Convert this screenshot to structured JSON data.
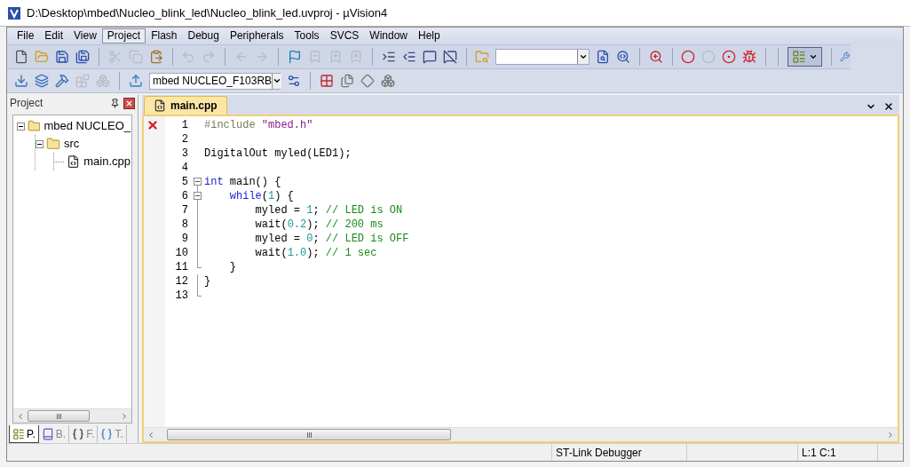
{
  "window": {
    "title": "D:\\Desktop\\mbed\\Nucleo_blink_led\\Nucleo_blink_led.uvproj - µVision4"
  },
  "menu": [
    {
      "label": "File",
      "selected": false
    },
    {
      "label": "Edit",
      "selected": false
    },
    {
      "label": "View",
      "selected": false
    },
    {
      "label": "Project",
      "selected": true
    },
    {
      "label": "Flash",
      "selected": false
    },
    {
      "label": "Debug",
      "selected": false
    },
    {
      "label": "Peripherals",
      "selected": false
    },
    {
      "label": "Tools",
      "selected": false
    },
    {
      "label": "SVCS",
      "selected": false
    },
    {
      "label": "Window",
      "selected": false
    },
    {
      "label": "Help",
      "selected": false
    }
  ],
  "toolbar_1": {
    "buttons": [
      {
        "disabled": false
      },
      {
        "disabled": false
      },
      {
        "disabled": false
      },
      {
        "disabled": false
      },
      {
        "disabled": true
      },
      {
        "disabled": true
      },
      {
        "disabled": false
      },
      {
        "disabled": true
      },
      {
        "disabled": true
      },
      {
        "disabled": true
      },
      {
        "disabled": true
      },
      {
        "disabled": false
      },
      {
        "disabled": true
      },
      {
        "disabled": true
      },
      {
        "disabled": true
      },
      {
        "disabled": false
      },
      {
        "disabled": false
      },
      {
        "disabled": false
      },
      {
        "disabled": false
      },
      {
        "disabled": false
      }
    ],
    "buttons_after_search": [
      {
        "disabled": false
      },
      {
        "disabled": false
      },
      {
        "disabled": false
      },
      {
        "disabled": false
      },
      {
        "disabled": true
      },
      {
        "disabled": false
      },
      {
        "disabled": false
      }
    ],
    "view_button": {
      "pressed": true
    }
  },
  "toolbar_2": {
    "buttons": [
      {
        "disabled": false
      },
      {
        "disabled": false
      },
      {
        "disabled": false
      },
      {
        "disabled": true
      },
      {
        "disabled": true
      },
      {
        "disabled": false
      }
    ],
    "target": "mbed NUCLEO_F103RB",
    "buttons_after_target": [
      {
        "disabled": false
      },
      {
        "disabled": false
      },
      {
        "disabled": false
      },
      {
        "disabled": false
      },
      {
        "disabled": false
      }
    ]
  },
  "project_panel": {
    "title": "Project",
    "tree": [
      {
        "label": "mbed NUCLEO_",
        "kind": "target",
        "expanded": true,
        "children": [
          {
            "label": "src",
            "kind": "folder",
            "expanded": true,
            "children": [
              {
                "label": "main.cpp",
                "kind": "file",
                "selected": false
              }
            ]
          }
        ]
      }
    ],
    "tabs": [
      {
        "label": "P.",
        "selected": true
      },
      {
        "label": "B.",
        "selected": false
      },
      {
        "label": "F.",
        "selected": false
      },
      {
        "label": "T.",
        "selected": false
      }
    ]
  },
  "editor": {
    "tabs": [
      {
        "label": "main.cpp",
        "selected": true
      }
    ],
    "lines": [
      {
        "number": "1",
        "error": true,
        "fold_box": false,
        "fold_guide": false,
        "fold_end": false,
        "tokens": [
          {
            "kind": "preproc",
            "text": "#include "
          },
          {
            "kind": "string",
            "text": "\"mbed.h\""
          }
        ]
      },
      {
        "number": "2",
        "error": false,
        "fold_box": false,
        "fold_guide": false,
        "fold_end": false
      },
      {
        "number": "3",
        "error": false,
        "fold_box": false,
        "fold_guide": false,
        "fold_end": false,
        "tokens": [
          {
            "kind": "plain",
            "text": "DigitalOut myled(LED1);"
          }
        ]
      },
      {
        "number": "4",
        "error": false,
        "fold_box": false,
        "fold_guide": false,
        "fold_end": false
      },
      {
        "number": "5",
        "error": false,
        "fold_box": true,
        "fold_guide": false,
        "fold_end": false,
        "tokens": [
          {
            "kind": "keyword",
            "text": "int"
          },
          {
            "kind": "plain",
            "text": " main() {"
          }
        ]
      },
      {
        "number": "6",
        "error": false,
        "fold_box": true,
        "fold_guide": true,
        "fold_end": false,
        "tokens": [
          {
            "kind": "keyword",
            "text": "    while"
          },
          {
            "kind": "plain",
            "text": "("
          },
          {
            "kind": "number",
            "text": "1"
          },
          {
            "kind": "plain",
            "text": ") {"
          }
        ]
      },
      {
        "number": "7",
        "error": false,
        "fold_box": false,
        "fold_guide": true,
        "fold_end": false,
        "tokens": [
          {
            "kind": "plain",
            "text": "        myled = "
          },
          {
            "kind": "number",
            "text": "1"
          },
          {
            "kind": "plain",
            "text": "; "
          },
          {
            "kind": "comment",
            "text": "// LED is ON"
          }
        ]
      },
      {
        "number": "8",
        "error": false,
        "fold_box": false,
        "fold_guide": true,
        "fold_end": false,
        "tokens": [
          {
            "kind": "plain",
            "text": "        wait("
          },
          {
            "kind": "number",
            "text": "0.2"
          },
          {
            "kind": "plain",
            "text": "); "
          },
          {
            "kind": "comment",
            "text": "// 200 ms"
          }
        ]
      },
      {
        "number": "9",
        "error": false,
        "fold_box": false,
        "fold_guide": true,
        "fold_end": false,
        "tokens": [
          {
            "kind": "plain",
            "text": "        myled = "
          },
          {
            "kind": "number",
            "text": "0"
          },
          {
            "kind": "plain",
            "text": "; "
          },
          {
            "kind": "comment",
            "text": "// LED is OFF"
          }
        ]
      },
      {
        "number": "10",
        "error": false,
        "fold_box": false,
        "fold_guide": true,
        "fold_end": false,
        "tokens": [
          {
            "kind": "plain",
            "text": "        wait("
          },
          {
            "kind": "number",
            "text": "1.0"
          },
          {
            "kind": "plain",
            "text": "); "
          },
          {
            "kind": "comment",
            "text": "// 1 sec"
          }
        ]
      },
      {
        "number": "11",
        "error": false,
        "fold_box": false,
        "fold_guide": true,
        "fold_end": true,
        "tokens": [
          {
            "kind": "plain",
            "text": "    }"
          }
        ]
      },
      {
        "number": "12",
        "error": false,
        "fold_box": false,
        "fold_guide": true,
        "fold_end": false,
        "tokens": [
          {
            "kind": "plain",
            "text": "}"
          }
        ]
      },
      {
        "number": "13",
        "error": false,
        "fold_box": false,
        "fold_guide": true,
        "fold_end": true
      }
    ]
  },
  "status_bar": {
    "debugger": "ST-Link Debugger",
    "position": "L:1 C:1"
  }
}
